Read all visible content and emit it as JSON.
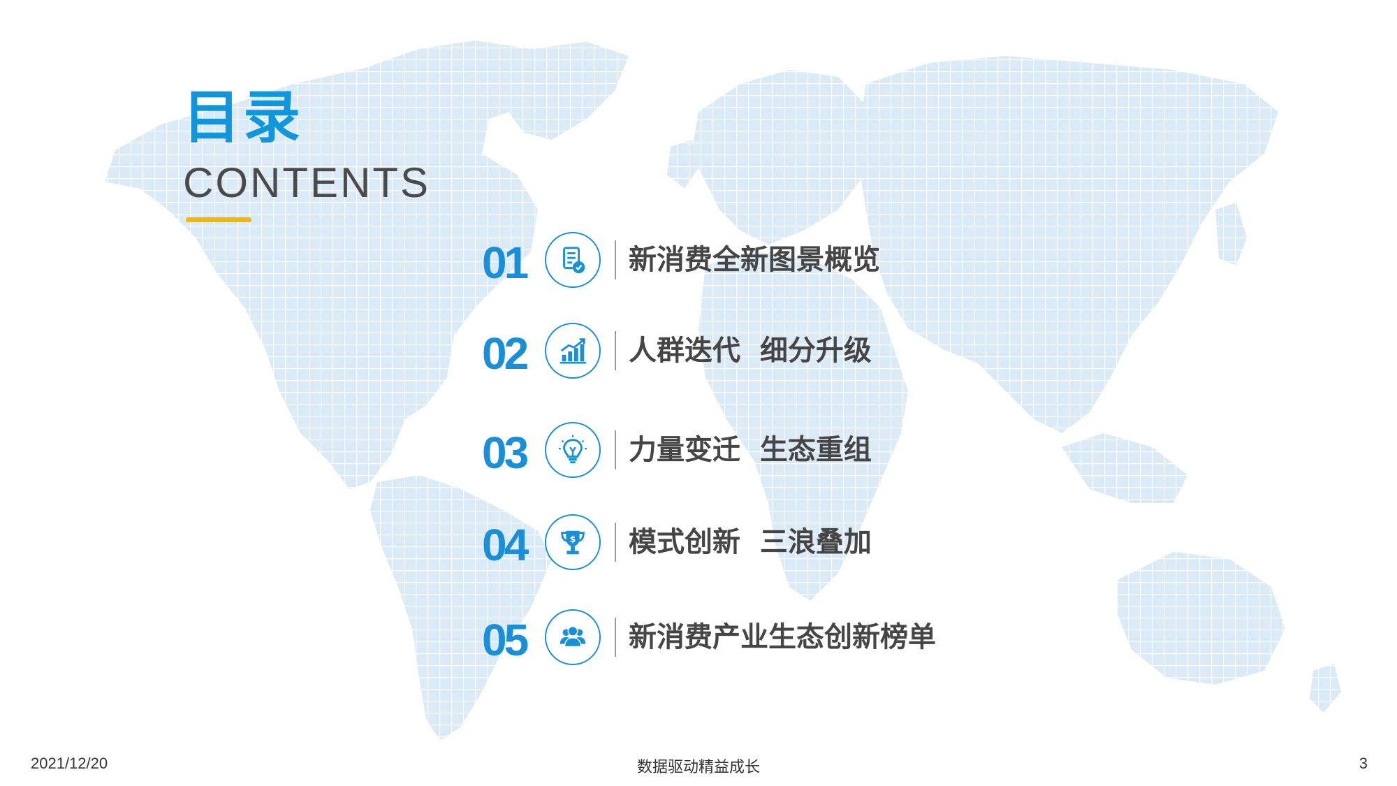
{
  "title": {
    "cn": "目录",
    "en": "CONTENTS"
  },
  "toc": [
    {
      "num": "01",
      "icon": "document-check-icon",
      "label": "新消费全新图景概览"
    },
    {
      "num": "02",
      "icon": "growth-chart-icon",
      "label": "人群迭代  细分升级"
    },
    {
      "num": "03",
      "icon": "lightbulb-icon",
      "label": "力量变迁  生态重组"
    },
    {
      "num": "04",
      "icon": "trophy-icon",
      "label": "模式创新  三浪叠加"
    },
    {
      "num": "05",
      "icon": "user-group-icon",
      "label": "新消费产业生态创新榜单"
    }
  ],
  "footer": {
    "date": "2021/12/20",
    "center": "数据驱动精益成长",
    "page": "3"
  },
  "colors": {
    "accent": "#1a8fd8",
    "underline": "#f5b800",
    "text": "#454545",
    "map": "#dcecf8"
  }
}
